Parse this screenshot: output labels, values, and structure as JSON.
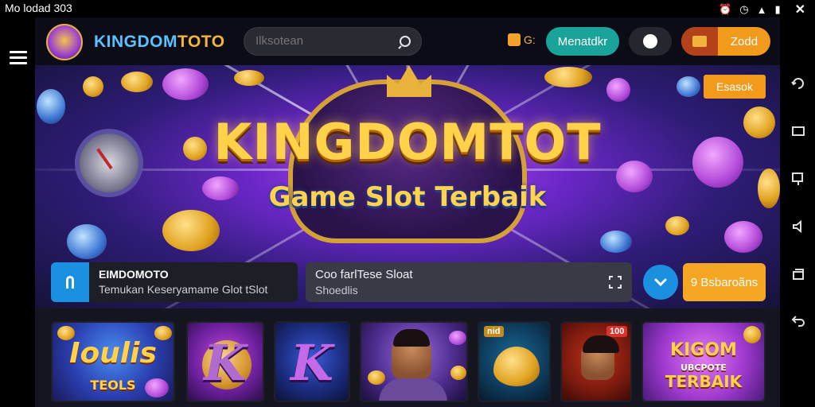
{
  "status_bar": {
    "text": "Mo lodad 303"
  },
  "header": {
    "brand_a": "KINGDOM",
    "brand_b": "TOTO",
    "search_placeholder": "Ilksotean",
    "coin_label": "G:",
    "login_label": "Menatdkr",
    "register_label": "Zodd"
  },
  "hero": {
    "title": "KINGDOMTOT",
    "subtitle": "Game Slot Terbaik",
    "badge": "Esasok"
  },
  "info": {
    "title": "EIMDOMOTO",
    "desc": "Temukan Keseryamame Glot tSlot"
  },
  "promo": {
    "title": "Coo farlTese Sloat",
    "sub": "Shoedlis"
  },
  "cta": {
    "label": "9 Bsbaroãns"
  },
  "games": [
    {
      "label": "Ioulis",
      "sub": "TEOLS"
    },
    {
      "label": "K"
    },
    {
      "label": "K"
    },
    {
      "label": ""
    },
    {
      "label": "",
      "tag": "nid"
    },
    {
      "label": "",
      "tag": "100"
    },
    {
      "label": "KIGOM",
      "sub": "UBCPOTE",
      "sub2": "TERBAIK"
    }
  ],
  "colors": {
    "teal": "#1aa39a",
    "orange": "#f29a1c",
    "blue": "#1b8fe0",
    "gold": "#f2b43c"
  }
}
